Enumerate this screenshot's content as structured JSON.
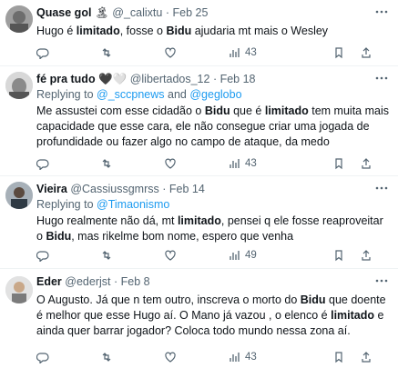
{
  "tweets": [
    {
      "name": "Quase gol",
      "name_emoji": "🏝",
      "handle": "@_calixtu",
      "date": "Feb 25",
      "replying": null,
      "segments": [
        {
          "t": "Hugo é "
        },
        {
          "t": "limitado",
          "b": true
        },
        {
          "t": ", fosse o "
        },
        {
          "t": "Bidu",
          "b": true
        },
        {
          "t": " ajudaria mt mais o Wesley"
        }
      ],
      "views": "43"
    },
    {
      "name": "fé pra tudo",
      "name_emoji": "🖤🤍",
      "handle": "@libertados_12",
      "date": "Feb 18",
      "replying": {
        "prefix": "Replying to ",
        "users": [
          "@_sccpnews",
          "@geglobo"
        ],
        "joiner": " and "
      },
      "segments": [
        {
          "t": "Me assustei com esse cidadão o "
        },
        {
          "t": "Bidu",
          "b": true
        },
        {
          "t": " que é "
        },
        {
          "t": "limitado",
          "b": true
        },
        {
          "t": " tem muita mais capacidade que esse cara, ele não consegue criar uma jogada de profundidade ou fazer algo no campo de ataque, da medo"
        }
      ],
      "views": "43"
    },
    {
      "name": "Vieira",
      "name_emoji": "",
      "handle": "@Cassiussgmrss",
      "date": "Feb 14",
      "replying": {
        "prefix": "Replying to ",
        "users": [
          "@Timaonismo"
        ],
        "joiner": ""
      },
      "segments": [
        {
          "t": "Hugo realmente não dá, mt "
        },
        {
          "t": "limitado",
          "b": true
        },
        {
          "t": ", pensei q ele fosse reaproveitar o "
        },
        {
          "t": "Bidu",
          "b": true
        },
        {
          "t": ", mas rikelme bom nome, espero que venha"
        }
      ],
      "views": "49"
    },
    {
      "name": "Eder",
      "name_emoji": "",
      "handle": "@ederjst",
      "date": "Feb 8",
      "replying": null,
      "segments": [
        {
          "t": "O Augusto. Já que n tem outro, inscreva o morto do "
        },
        {
          "t": "Bidu",
          "b": true
        },
        {
          "t": " que doente é melhor que esse Hugo aí. O Mano já vazou , o elenco é "
        },
        {
          "t": "limitado",
          "b": true
        },
        {
          "t": " e ainda quer barrar jogador? Coloca todo mundo nessa zona aí."
        }
      ],
      "views": "43"
    }
  ],
  "colors": {
    "accent": "#1d9bf0",
    "muted": "#536471",
    "text": "#0f1419",
    "divider": "#eff3f4"
  },
  "icons": [
    "reply-icon",
    "retweet-icon",
    "like-icon",
    "views-icon",
    "bookmark-icon",
    "share-icon",
    "more-icon"
  ]
}
